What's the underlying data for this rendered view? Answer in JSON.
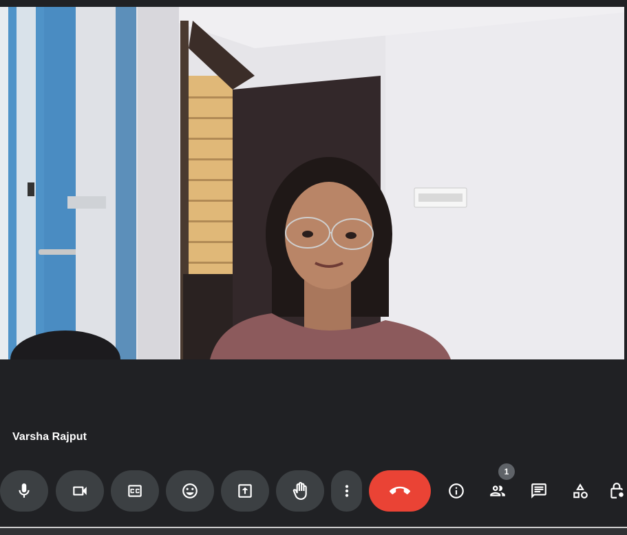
{
  "participant": {
    "name": "Varsha Rajput"
  },
  "controls": {
    "mic": "microphone",
    "camera": "camera",
    "captions": "captions",
    "reactions": "reactions",
    "present": "present-screen",
    "raise_hand": "raise-hand",
    "more": "more-options",
    "end_call": "leave-call"
  },
  "side_controls": {
    "people_count": "1"
  },
  "colors": {
    "background": "#202124",
    "control_bg": "#3c4043",
    "end_call": "#ea4335",
    "badge_bg": "#5f6368"
  }
}
